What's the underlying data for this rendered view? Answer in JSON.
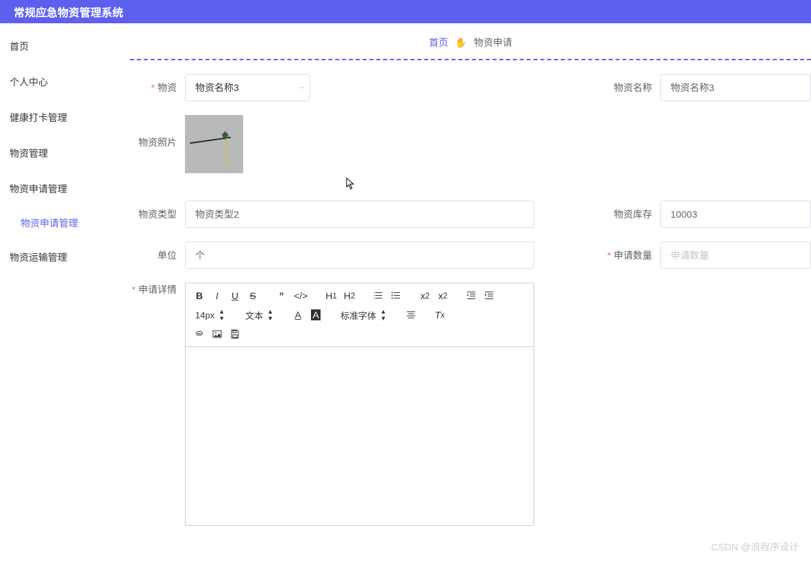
{
  "header": {
    "title": "常规应急物资管理系统"
  },
  "sidebar": {
    "items": [
      {
        "label": "首页"
      },
      {
        "label": "个人中心"
      },
      {
        "label": "健康打卡管理"
      },
      {
        "label": "物资管理"
      },
      {
        "label": "物资申请管理",
        "children": [
          {
            "label": "物资申请管理"
          }
        ]
      },
      {
        "label": "物资运输管理"
      }
    ]
  },
  "breadcrumb": {
    "home": "首页",
    "emoji": "✋",
    "current": "物资申请"
  },
  "form": {
    "wuzi_label": "物资",
    "wuzi_value": "物资名称3",
    "wuzi_name_label": "物资名称",
    "wuzi_name_value": "物资名称3",
    "photo_label": "物资照片",
    "type_label": "物资类型",
    "type_value": "物资类型2",
    "stock_label": "物资库存",
    "stock_value": "10003",
    "unit_label": "单位",
    "unit_value": "个",
    "qty_label": "申请数量",
    "qty_placeholder": "申请数量",
    "detail_label": "申请详情"
  },
  "editor_toolbar": {
    "font_size": "14px",
    "font_style": "文本",
    "font_family": "标准字体"
  },
  "watermark": "CSDN @浪程序设计"
}
